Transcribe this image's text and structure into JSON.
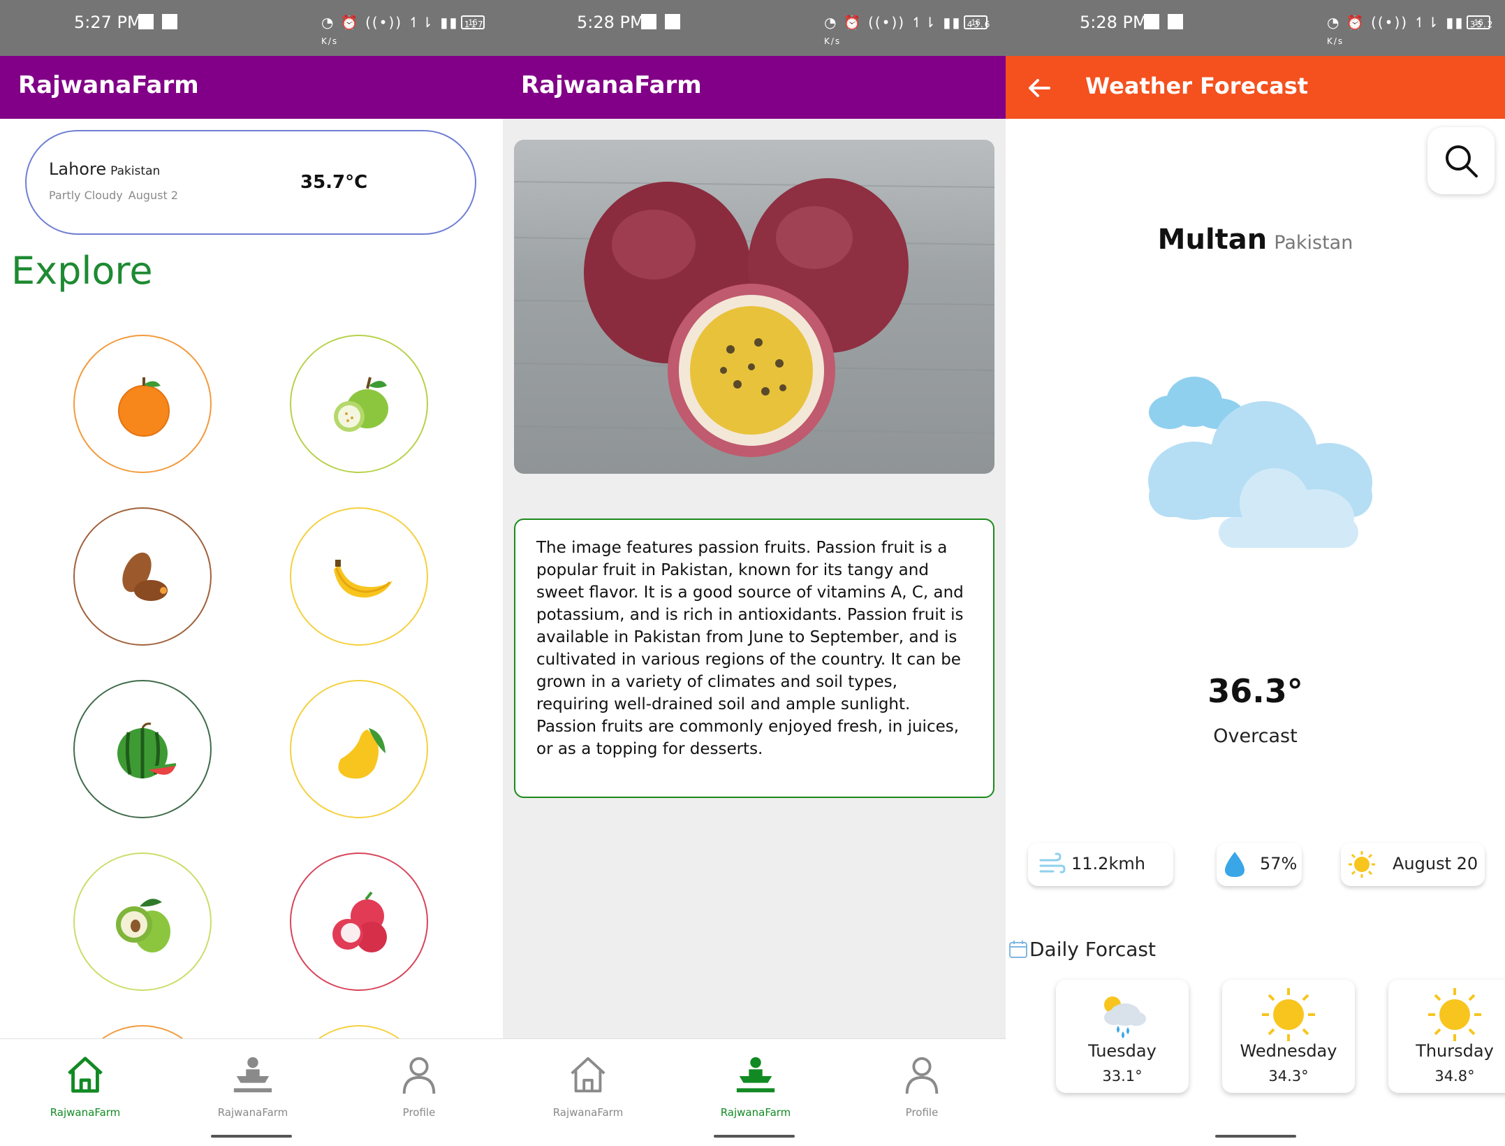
{
  "screens": [
    {
      "status": {
        "time": "5:27 PM",
        "speed": "117 K/s",
        "battery": "16"
      },
      "appbar": {
        "title": "RajwanaFarm"
      },
      "weather_card": {
        "city": "Lahore",
        "country": "Pakistan",
        "condition": "Partly Cloudy",
        "date": "August 2",
        "temperature": "35.7°C"
      },
      "explore_title": "Explore",
      "fruits": [
        "orange",
        "guava",
        "dates",
        "banana",
        "watermelon",
        "mango",
        "custard-apple",
        "lychee"
      ],
      "bottom_nav": {
        "items": [
          {
            "label": "RajwanaFarm",
            "active": true
          },
          {
            "label": "RajwanaFarm",
            "active": false
          },
          {
            "label": "Profile",
            "active": false
          }
        ]
      }
    },
    {
      "status": {
        "time": "5:28 PM",
        "speed": "43.6 K/s",
        "battery": "16"
      },
      "appbar": {
        "title": "RajwanaFarm"
      },
      "description": "The image features passion fruits. Passion fruit is a popular fruit in Pakistan, known for its tangy and sweet flavor. It is a good source of vitamins A, C, and potassium, and is rich in antioxidants. Passion fruit is available in Pakistan from June to September, and is cultivated in various regions of the country. It can be grown in a variety of climates and soil types, requiring well-drained soil and ample sunlight. Passion fruits are commonly enjoyed fresh, in juices, or as a topping for desserts.",
      "bottom_nav": {
        "items": [
          {
            "label": "RajwanaFarm",
            "active": false
          },
          {
            "label": "RajwanaFarm",
            "active": true
          },
          {
            "label": "Profile",
            "active": false
          }
        ]
      }
    },
    {
      "status": {
        "time": "5:28 PM",
        "speed": "35.2 K/s",
        "battery": "16"
      },
      "appbar": {
        "title": "Weather Forecast"
      },
      "location": {
        "city": "Multan",
        "country": "Pakistan"
      },
      "current": {
        "temperature": "36.3°",
        "condition": "Overcast"
      },
      "stats": {
        "wind": "11.2kmh",
        "humidity": "57%",
        "date": "August 20"
      },
      "daily_title": "Daily Forcast",
      "daily": [
        {
          "day": "Tuesday",
          "temp": "33.1°",
          "icon": "rain-cloud-icon"
        },
        {
          "day": "Wednesday",
          "temp": "34.3°",
          "icon": "sun-icon"
        },
        {
          "day": "Thursday",
          "temp": "34.8°",
          "icon": "sun-icon"
        }
      ]
    }
  ],
  "colors": {
    "appbar_purple": "#820087",
    "appbar_orange": "#f4511e",
    "accent_green": "#128a23",
    "explore_green": "#1e8a32"
  }
}
